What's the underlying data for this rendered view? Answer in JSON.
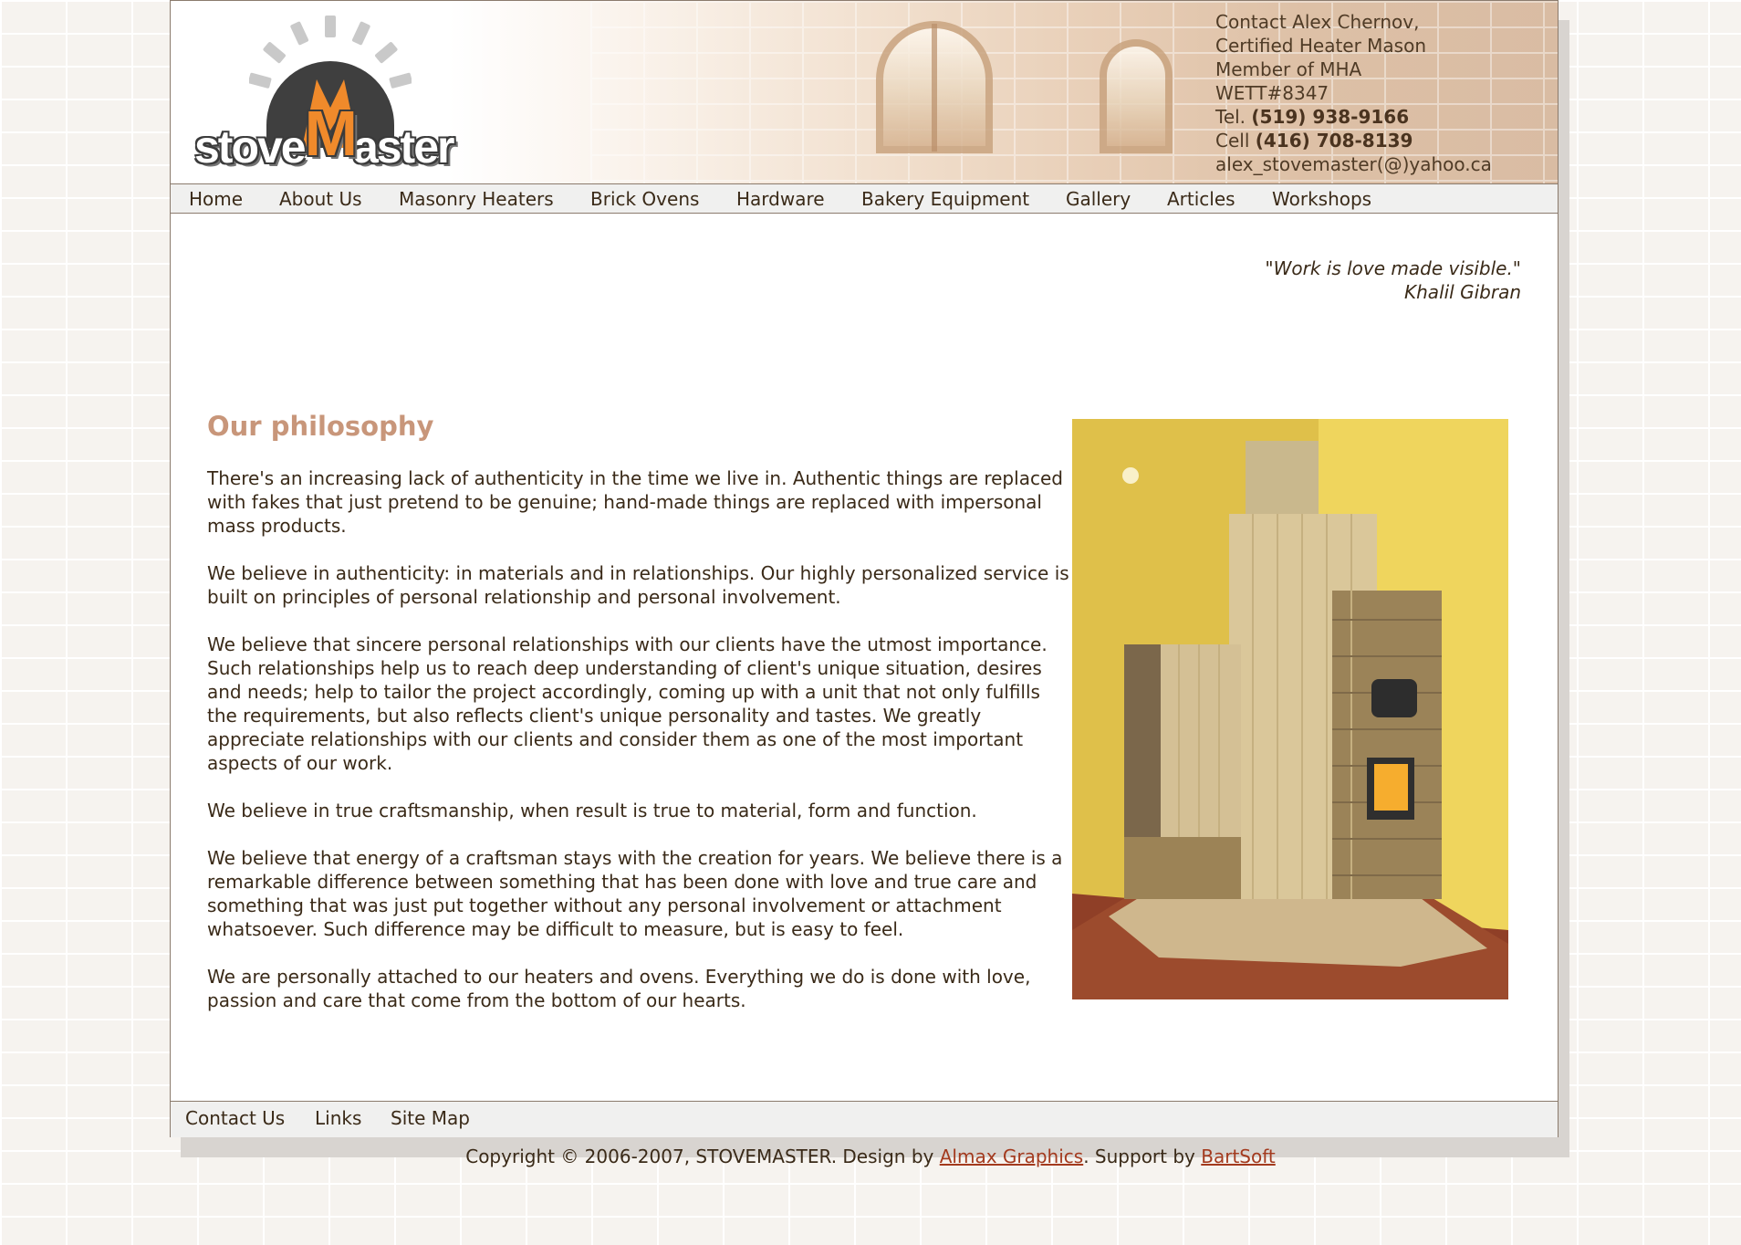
{
  "colors": {
    "heading": "#c8967a",
    "link": "#a33a1e",
    "text": "#3a2a18",
    "nav_bg": "#f0f0ef",
    "logo_orange": "#f08a2b",
    "logo_dark": "#3b3b3b"
  },
  "logo": {
    "text_before": "stove",
    "text_letter": "M",
    "text_after": "aster",
    "icon": "sun-rays-logo-icon"
  },
  "contact": {
    "lines": [
      "Contact Alex Chernov,",
      "Certified Heater Mason",
      "Member of MHA",
      "WETT#8347"
    ],
    "tel_label": "Tel. ",
    "tel_number": "(519) 938-9166",
    "cell_label": "Cell ",
    "cell_number": "(416) 708-8139",
    "email": "alex_stovemaster(@)yahoo.ca"
  },
  "nav": {
    "items": [
      "Home",
      "About Us",
      "Masonry Heaters",
      "Brick Ovens",
      "Hardware",
      "Bakery Equipment",
      "Gallery",
      "Articles",
      "Workshops"
    ]
  },
  "quote": {
    "text": "\"Work is love made visible.\"",
    "author": "Khalil Gibran"
  },
  "content": {
    "heading": "Our philosophy",
    "paragraphs": [
      "There's an increasing lack of authenticity in the time we live in. Authentic things are replaced with fakes that just pretend to be genuine; hand-made things are replaced with impersonal mass products.",
      "We believe in authenticity: in materials and in relationships. Our highly personalized service is built on principles of personal relationship and personal involvement.",
      "We believe that sincere personal relationships with our clients have the utmost importance. Such relationships help us to reach deep understanding of client's unique situation, desires and needs; help to tailor the project accordingly, coming up with a unit that not only fulfills the requirements, but also reflects client's unique personality and tastes. We greatly appreciate relationships with our clients and consider them as one of the most important aspects of our work.",
      "We believe in true craftsmanship, when result is true to material, form and function.",
      "We believe that energy of a craftsman stays with the creation for years. We believe there is a remarkable difference between something that has been done with love and true care and something that was just put together without any personal involvement or attachment whatsoever. Such difference may be difficult to measure, but is easy to feel.",
      "We are personally attached to our heaters and ovens. Everything we do is done with love, passion and care that come from the bottom of our hearts."
    ]
  },
  "photo": {
    "icon": "masonry-heater-photo-icon"
  },
  "footer": {
    "items": [
      "Contact Us",
      "Links",
      "Site Map"
    ],
    "copyright_prefix": "Copyright © 2006-2007, STOVEMASTER. Design by ",
    "link1": "Almax Graphics",
    "middle": ". Support by ",
    "link2": "BartSoft"
  }
}
